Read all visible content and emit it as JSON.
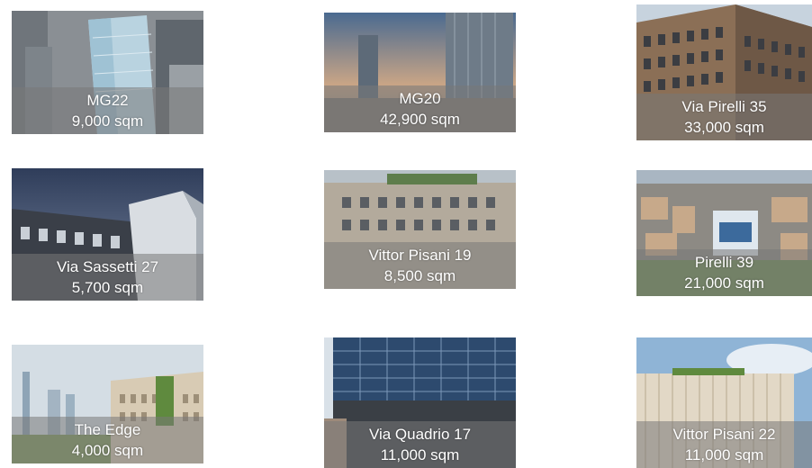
{
  "properties": [
    {
      "name": "MG22",
      "area": "9,000 sqm"
    },
    {
      "name": "MG20",
      "area": "42,900 sqm"
    },
    {
      "name": "Via Pirelli 35",
      "area": "33,000 sqm"
    },
    {
      "name": "Via Sassetti 27",
      "area": "5,700 sqm"
    },
    {
      "name": "Vittor Pisani 19",
      "area": "8,500 sqm"
    },
    {
      "name": "Pirelli 39",
      "area": "21,000 sqm"
    },
    {
      "name": "The Edge",
      "area": "4,000 sqm"
    },
    {
      "name": "Via Quadrio 17",
      "area": "11,000 sqm"
    },
    {
      "name": "Vittor Pisani 22",
      "area": "11,000 sqm"
    }
  ]
}
